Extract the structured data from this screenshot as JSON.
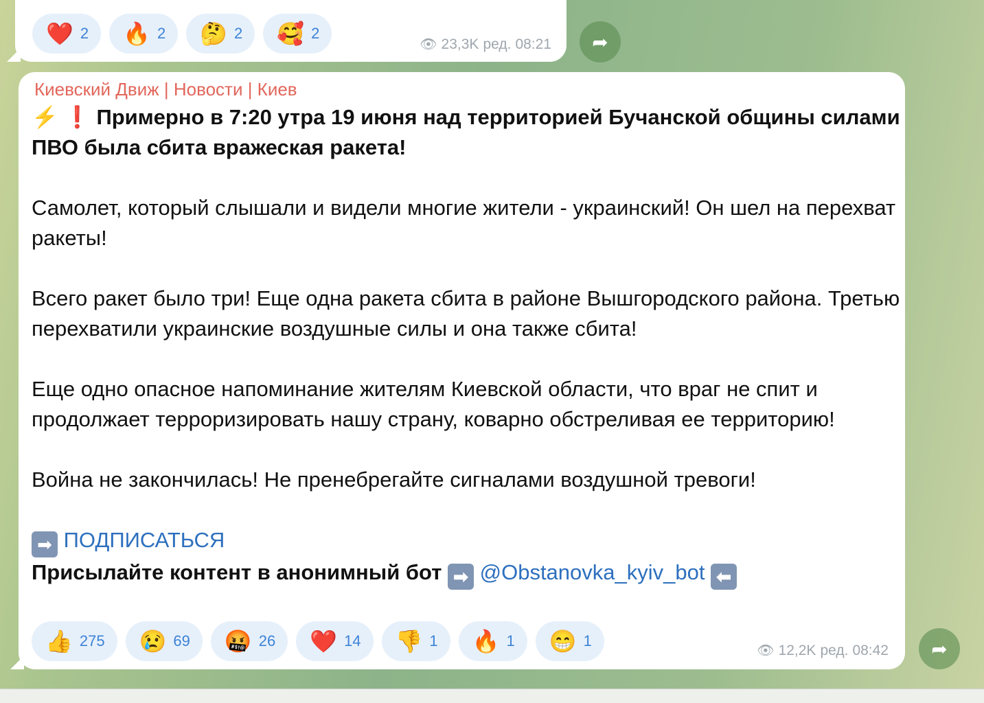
{
  "prev_message": {
    "reactions": [
      {
        "emoji": "❤️",
        "count": "2"
      },
      {
        "emoji": "🔥",
        "count": "2"
      },
      {
        "emoji": "🤔",
        "count": "2"
      },
      {
        "emoji": "🥰",
        "count": "2"
      }
    ],
    "views": "23,3K",
    "edited": "ред.",
    "time": "08:21"
  },
  "message": {
    "channel": "Киевский Движ | Новости | Киев",
    "headline_emoji": "⚡ ❗",
    "headline": "Примерно в 7:20 утра 19 июня над территорией Бучанской общины силами ПВО была сбита вражеская ракета!",
    "paragraphs": [
      "Самолет, который слышали и видели многие жители - украинский! Он шел на перехват ракеты!",
      "Всего ракет было три! Еще одна ракета сбита в районе Вышгородского района. Третью перехватили украинские воздушные силы и она также сбита!",
      "Еще одно опасное напоминание жителям Киевской области, что враг не спит и продолжает терроризировать нашу страну, коварно обстреливая ее территорию!",
      "Война не закончилась! Не пренебрегайте сигналами воздушной тревоги!"
    ],
    "subscribe_arrow": "➡",
    "subscribe": "ПОДПИСАТЬСЯ",
    "bot_text": "Присылайте контент в анонимный бот",
    "arrow_right": "➡",
    "bot_link": "@Obstanovka_kyiv_bot",
    "arrow_left": "⬅",
    "reactions": [
      {
        "emoji": "👍",
        "count": "275"
      },
      {
        "emoji": "😢",
        "count": "69"
      },
      {
        "emoji": "🤬",
        "count": "26"
      },
      {
        "emoji": "❤️",
        "count": "14"
      },
      {
        "emoji": "👎",
        "count": "1"
      },
      {
        "emoji": "🔥",
        "count": "1"
      },
      {
        "emoji": "😁",
        "count": "1"
      }
    ],
    "views": "12,2K",
    "edited": "ред.",
    "time": "08:42"
  },
  "icons": {
    "eye": "👁",
    "forward": "➦"
  }
}
